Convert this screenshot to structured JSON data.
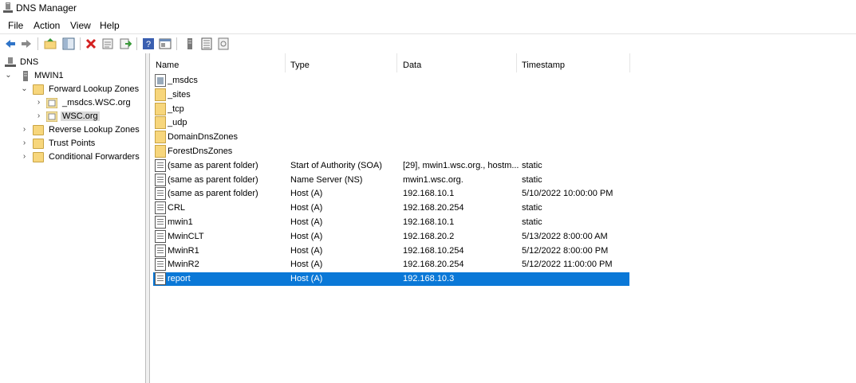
{
  "window": {
    "title": "DNS Manager"
  },
  "menu": [
    "File",
    "Action",
    "View",
    "Help"
  ],
  "toolbar": {
    "icons": [
      "back-icon",
      "forward-icon",
      "up-folder-icon",
      "show-hide-tree-icon",
      "delete-icon",
      "properties-icon",
      "export-list-icon",
      "help-icon",
      "console-icon",
      "server-icon",
      "record-list-icon",
      "refresh-icon"
    ]
  },
  "tree": {
    "root": "DNS",
    "server": "MWIN1",
    "forward_zones": "Forward Lookup Zones",
    "msdcs_zone": "_msdcs.WSC.org",
    "wsc_zone": "WSC.org",
    "reverse_zones": "Reverse Lookup Zones",
    "trust_points": "Trust Points",
    "conditional_forwarders": "Conditional Forwarders"
  },
  "columns": {
    "name": "Name",
    "type": "Type",
    "data": "Data",
    "timestamp": "Timestamp"
  },
  "rows": [
    {
      "name": "_msdcs",
      "type": "",
      "data": "",
      "timestamp": "",
      "icon": "msdcs-icon"
    },
    {
      "name": "_sites",
      "type": "",
      "data": "",
      "timestamp": "",
      "icon": "folder-icon"
    },
    {
      "name": "_tcp",
      "type": "",
      "data": "",
      "timestamp": "",
      "icon": "folder-icon"
    },
    {
      "name": "_udp",
      "type": "",
      "data": "",
      "timestamp": "",
      "icon": "folder-icon"
    },
    {
      "name": "DomainDnsZones",
      "type": "",
      "data": "",
      "timestamp": "",
      "icon": "folder-icon"
    },
    {
      "name": "ForestDnsZones",
      "type": "",
      "data": "",
      "timestamp": "",
      "icon": "folder-icon"
    },
    {
      "name": "(same as parent folder)",
      "type": "Start of Authority (SOA)",
      "data": "[29], mwin1.wsc.org., hostm...",
      "timestamp": "static",
      "icon": "record-icon"
    },
    {
      "name": "(same as parent folder)",
      "type": "Name Server (NS)",
      "data": "mwin1.wsc.org.",
      "timestamp": "static",
      "icon": "record-icon"
    },
    {
      "name": "(same as parent folder)",
      "type": "Host (A)",
      "data": "192.168.10.1",
      "timestamp": "5/10/2022 10:00:00 PM",
      "icon": "record-icon"
    },
    {
      "name": "CRL",
      "type": "Host (A)",
      "data": "192.168.20.254",
      "timestamp": "static",
      "icon": "record-icon"
    },
    {
      "name": "mwin1",
      "type": "Host (A)",
      "data": "192.168.10.1",
      "timestamp": "static",
      "icon": "record-icon"
    },
    {
      "name": "MwinCLT",
      "type": "Host (A)",
      "data": "192.168.20.2",
      "timestamp": "5/13/2022 8:00:00 AM",
      "icon": "record-icon"
    },
    {
      "name": "MwinR1",
      "type": "Host (A)",
      "data": "192.168.10.254",
      "timestamp": "5/12/2022 8:00:00 PM",
      "icon": "record-icon"
    },
    {
      "name": "MwinR2",
      "type": "Host (A)",
      "data": "192.168.20.254",
      "timestamp": "5/12/2022 11:00:00 PM",
      "icon": "record-icon"
    },
    {
      "name": "report",
      "type": "Host (A)",
      "data": "192.168.10.3",
      "timestamp": "",
      "icon": "record-icon",
      "selected": true
    }
  ],
  "colors": {
    "selection": "#0a78d7",
    "folder": "#f7d67c"
  }
}
